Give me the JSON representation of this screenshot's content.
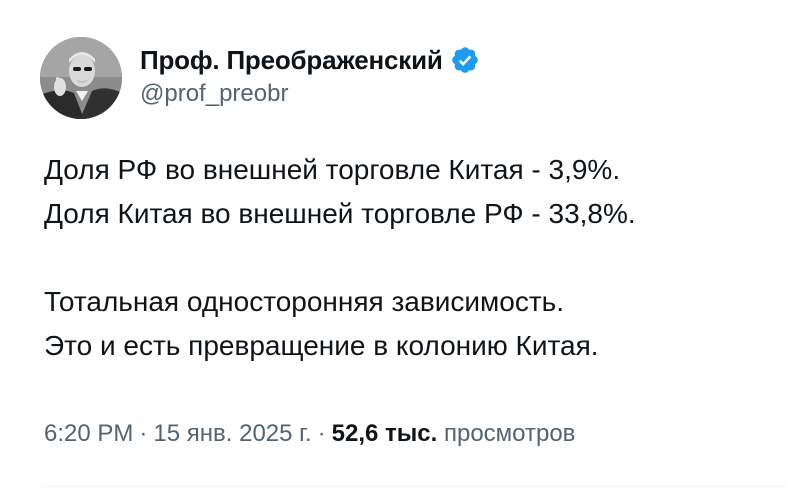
{
  "author": {
    "display_name": "Проф. Преображенский",
    "handle": "@prof_preobr",
    "verified_icon": "verified-badge-icon",
    "verified_color": "#1d9bf0"
  },
  "tweet": {
    "lines": [
      "Доля РФ во внешней торговле Китая - 3,9%.",
      "Доля Китая во внешней торговле РФ - 33,8%.",
      "Тотальная односторонняя зависимость.",
      "Это и есть превращение в колонию Китая."
    ]
  },
  "meta": {
    "time": "6:20 PM",
    "date": "15 янв. 2025 г.",
    "separator": "·",
    "views_count": "52,6 тыс.",
    "views_label": "просмотров"
  },
  "colors": {
    "text": "#0f1419",
    "secondary": "#536471"
  }
}
